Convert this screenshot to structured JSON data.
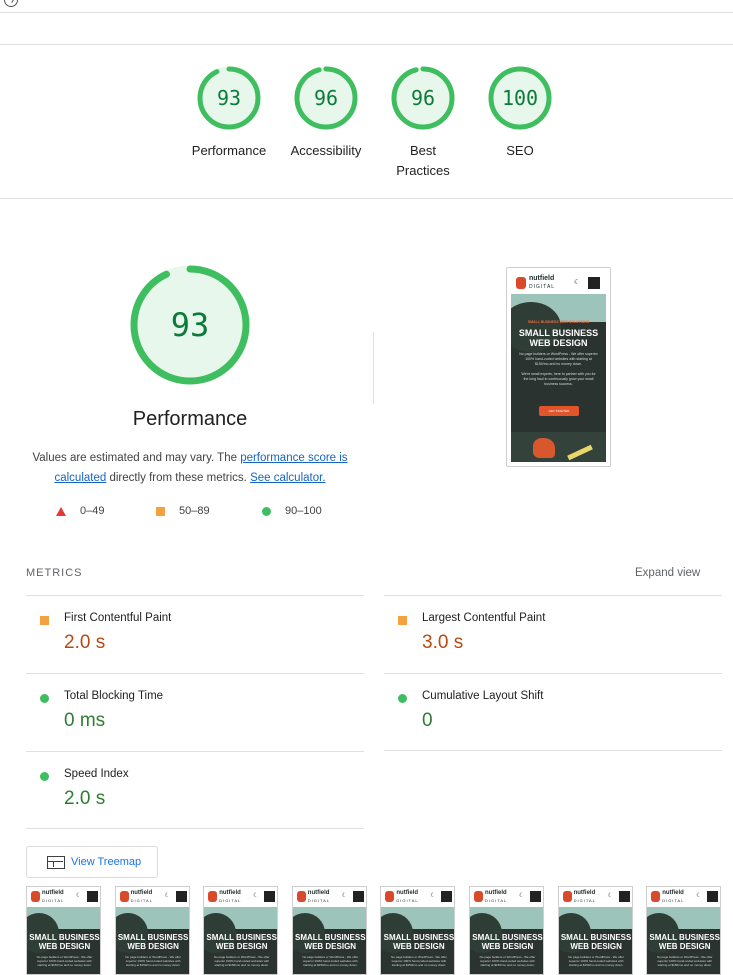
{
  "colors": {
    "pass": "#0b7a3a",
    "pass_ring": "#3fbe5f",
    "pass_fill": "#e8f7ec",
    "average": "#b54a14",
    "average_marker": "#f4a142",
    "fail": "#e53935",
    "link": "#1565c0"
  },
  "scores": [
    {
      "label": "Performance",
      "value": "93",
      "fraction": 0.93
    },
    {
      "label": "Accessibility",
      "value": "96",
      "fraction": 0.96
    },
    {
      "label": "Best Practices",
      "value": "96",
      "fraction": 0.96
    },
    {
      "label": "SEO",
      "value": "100",
      "fraction": 1.0
    }
  ],
  "performance": {
    "score": "93",
    "fraction": 0.93,
    "title": "Performance",
    "note_prefix": "Values are estimated and may vary. The ",
    "note_link1": "performance score is calculated",
    "note_middle": " directly from these metrics. ",
    "note_link2": "See calculator."
  },
  "legend": [
    {
      "shape": "triangle",
      "range": "0–49"
    },
    {
      "shape": "square",
      "range": "50–89"
    },
    {
      "shape": "circle",
      "range": "90–100"
    }
  ],
  "screenshot": {
    "brand_name": "nutfield",
    "brand_sub": "DIGITAL",
    "kicker": "SMALL BUSINESS WEB SOLUTIONS",
    "headline": "SMALL BUSINESS WEB DESIGN",
    "body1": "No page builders or WordPress - We offer superior 100% hand-coded websites with starting at $150/mo and no money down.",
    "body2": "We're small experts, here to partner with you for the long haul to continuously grow your small business success.",
    "cta": "GET STARTED"
  },
  "metrics": {
    "title": "METRICS",
    "expand_label": "Expand view",
    "items": [
      {
        "label": "First Contentful Paint",
        "value": "2.0 s",
        "rating": "average"
      },
      {
        "label": "Largest Contentful Paint",
        "value": "3.0 s",
        "rating": "average"
      },
      {
        "label": "Total Blocking Time",
        "value": "0 ms",
        "rating": "pass"
      },
      {
        "label": "Cumulative Layout Shift",
        "value": "0",
        "rating": "pass"
      },
      {
        "label": "Speed Index",
        "value": "2.0 s",
        "rating": "pass"
      }
    ]
  },
  "treemap": {
    "label": "View Treemap"
  },
  "filmstrip": {
    "frame_count": 8
  }
}
